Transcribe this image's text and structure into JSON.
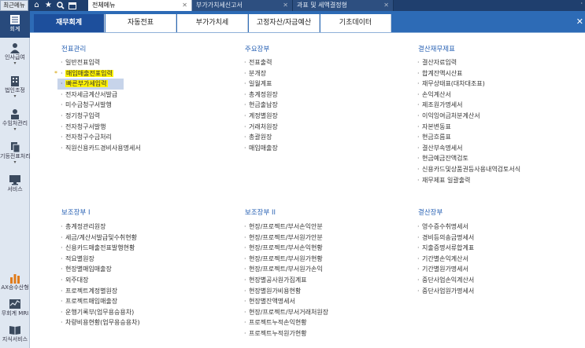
{
  "topbar": {
    "recent_label": "최근메뉴",
    "icons": [
      "home-icon",
      "star-icon",
      "search-icon",
      "calendar-icon"
    ],
    "tabs": [
      {
        "label": "전체메뉴",
        "active": true
      },
      {
        "label": "부가가치세신고서",
        "active": false
      },
      {
        "label": "과표 및 세액결정형",
        "active": false
      }
    ],
    "corner_mark": "·"
  },
  "rail": {
    "items": [
      {
        "label": "회계",
        "icon": "ledger-icon",
        "active": true
      },
      {
        "label": "인사급여",
        "icon": "person-icon"
      },
      {
        "label": "법인조정",
        "icon": "building-icon"
      },
      {
        "label": "수임처관리",
        "icon": "client-icon"
      },
      {
        "label": "기등전표처리",
        "icon": "slip-icon"
      },
      {
        "label": "서비스",
        "icon": "monitor-icon"
      },
      {
        "label": "AX승수산형",
        "icon": "chart-icon"
      },
      {
        "label": "무회계 MRI",
        "icon": "mri-icon"
      },
      {
        "label": "지식서비스",
        "icon": "book-icon"
      }
    ]
  },
  "menutabs": [
    {
      "label": "재무회계",
      "active": true
    },
    {
      "label": "자동전표"
    },
    {
      "label": "부가가치세"
    },
    {
      "label": "고정자산/자금예산"
    },
    {
      "label": "기초데이터"
    }
  ],
  "sections": {
    "slip": {
      "title": "전표관리",
      "items": [
        "일반전표입력",
        "매입매출전표입력",
        "빠른부가세입력",
        "전자세금계산서발급",
        "미수금청구서발행",
        "정기청구입력",
        "전자청구서발행",
        "전자청구수금처리",
        "직원신용카드경비사용명세서"
      ]
    },
    "main_ledger": {
      "title": "주요장부",
      "items": [
        "전표출력",
        "분개장",
        "일월계표",
        "총계정원장",
        "현금출납장",
        "계정별원장",
        "거래처원장",
        "총괄원장",
        "매입매출장"
      ]
    },
    "closing": {
      "title": "결산재무제표",
      "items": [
        "결산자료입력",
        "합계잔액시산표",
        "재무상태표(대차대조표)",
        "손익계산서",
        "제조원가명세서",
        "이익잉여금처분계산서",
        "자본변동표",
        "현금흐름표",
        "결산부속명세서",
        "현금예금잔액검토",
        "신용카드및상품권등사용내역검토서식",
        "재무제표 일괄출력"
      ]
    },
    "aux1": {
      "title": "보조장부 I",
      "items": [
        "총계정관리원장",
        "세금/계산서발급및수취현황",
        "신용카드매출전표발행현황",
        "적요별원장",
        "현장별매입매출장",
        "외주대장",
        "프로젝트계정별원장",
        "프로젝트매입매출장",
        "운행기록부(업무용승용차)",
        "차량비용현황(업무용승용차)"
      ]
    },
    "aux2": {
      "title": "보조장부 II",
      "items": [
        "현장/프로젝트/부서손익안분",
        "현장/프로젝트/부서원가안분",
        "현장/프로젝트/부서손익현황",
        "현장/프로젝트/부서원가현황",
        "현장/프로젝트/부서원가손익",
        "현장별공사원가집계표",
        "현장별원가비용현황",
        "현장별잔액명세서",
        "현장/프로젝트/부서거래처원장",
        "프로젝트누적손익현황",
        "프로젝트누적원가현황"
      ]
    },
    "closing_ledger": {
      "title": "결산장부",
      "items": [
        "영수증수취명세서",
        "경비등의송금명세서",
        "지출증명서류합계표",
        "기간별손익계산서",
        "기간별원가명세서",
        "중단사업손익계산서",
        "중단사업원가명세서"
      ]
    }
  },
  "colors": {
    "topbar": "#1f3f6e",
    "menutab_bar": "#2d6bb6",
    "active_tab": "#1d4f9c",
    "section_title": "#2962b4",
    "highlight_yellow": "#fff200",
    "highlight_row": "#c7d4ea"
  }
}
